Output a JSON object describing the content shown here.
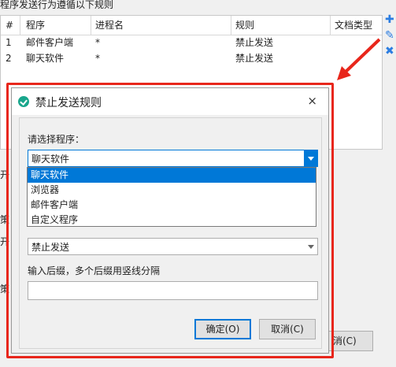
{
  "background": {
    "heading": "程序发送行为遵循以下规则",
    "table": {
      "columns": [
        "#",
        "程序",
        "进程名",
        "规则",
        "文档类型"
      ],
      "rows": [
        [
          "1",
          "邮件客户端",
          "*",
          "禁止发送",
          ""
        ],
        [
          "2",
          "聊天软件",
          "*",
          "禁止发送",
          ""
        ]
      ]
    },
    "side_icons": [
      "add-icon",
      "edit-icon",
      "delete-icon"
    ],
    "fragments": [
      "开",
      "策",
      "开",
      "策"
    ],
    "cancel_button_fragment": "消(C)"
  },
  "dialog": {
    "title": "禁止发送规则",
    "close_glyph": "×",
    "program_label": "请选择程序：",
    "program_select": {
      "value": "聊天软件",
      "options": [
        "聊天软件",
        "浏览器",
        "邮件客户端",
        "自定义程序"
      ],
      "selected_index": 0
    },
    "rule_select": {
      "value": "禁止发送"
    },
    "suffix_label": "输入后缀，多个后缀用竖线分隔",
    "suffix_input": {
      "value": ""
    },
    "ok_button": "确定(O)",
    "cancel_button": "取消(C)"
  },
  "colors": {
    "highlight": "#e8261b",
    "accent": "#0078d7",
    "icon_teal": "#19a68c"
  }
}
